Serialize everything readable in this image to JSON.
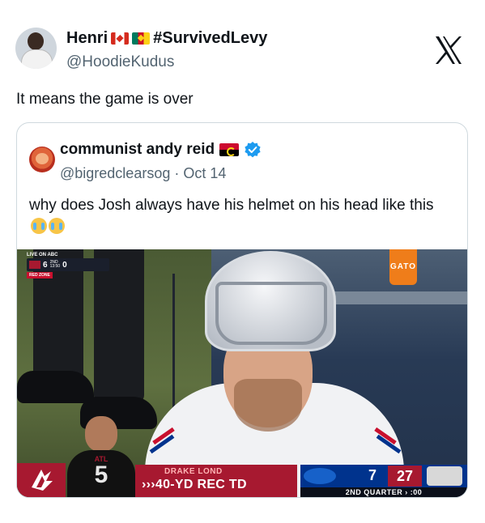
{
  "tweet": {
    "author_name": "Henri",
    "author_suffix": "#SurvivedLevy",
    "handle": "@HoodieKudus",
    "text": "It means the game is over"
  },
  "quoted_tweet": {
    "author_name": "communist andy reid",
    "handle": "@bigredclearsog",
    "separator": "·",
    "date": "Oct 14",
    "text": "why does Josh always have his helmet on his head like this"
  },
  "media": {
    "bug_top": "LIVE ON ABC",
    "bug_score": "6",
    "bug_down": "2ND",
    "bug_clock": "13:50",
    "bug_zero": "0",
    "bug_red": "RED ZONE",
    "bottle_text": "GATO",
    "lower_player_team": "ATL",
    "lower_player_number": "5",
    "lower_name": "DRAKE LOND",
    "lower_td": "›››40-YD REC TD",
    "score_home": "7",
    "score_away": "27",
    "quarter": "2ND QUARTER  › :00"
  },
  "colors": {
    "text": "#0f1419",
    "secondary": "#536471",
    "border": "#cfd9de",
    "verified": "#1d9bf0",
    "falcons_red": "#a71930",
    "bills_blue": "#00338d"
  },
  "icons": [
    "canada-flag-icon",
    "cameroon-flag-icon",
    "x-logo-icon",
    "angola-flag-icon",
    "verified-badge-icon",
    "crying-emoji-icon"
  ]
}
